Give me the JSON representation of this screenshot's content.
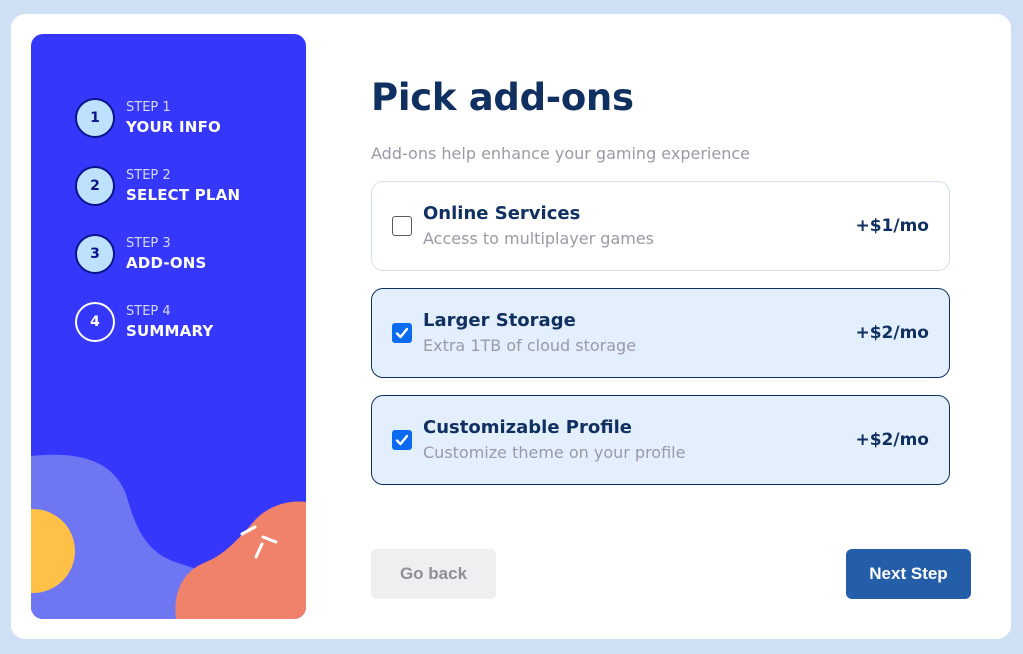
{
  "steps": [
    {
      "number": "1",
      "kicker": "STEP 1",
      "title": "YOUR INFO",
      "active": true
    },
    {
      "number": "2",
      "kicker": "STEP 2",
      "title": "SELECT PLAN",
      "active": true
    },
    {
      "number": "3",
      "kicker": "STEP 3",
      "title": "ADD-ONS",
      "active": true
    },
    {
      "number": "4",
      "kicker": "STEP 4",
      "title": "SUMMARY",
      "active": false
    }
  ],
  "main": {
    "title": "Pick add-ons",
    "subtitle": "Add-ons help enhance your gaming experience"
  },
  "addons": [
    {
      "name": "Online Services",
      "description": "Access to multiplayer games",
      "price": "+$1/mo",
      "checked": false
    },
    {
      "name": "Larger Storage",
      "description": "Extra 1TB of cloud storage",
      "price": "+$2/mo",
      "checked": true
    },
    {
      "name": "Customizable Profile",
      "description": "Customize theme on your profile",
      "price": "+$2/mo",
      "checked": true
    }
  ],
  "buttons": {
    "back_label": "Go back",
    "next_label": "Next Step"
  },
  "colors": {
    "sidebar": "#3538fb",
    "marine": "#0f3060",
    "accent": "#245da8",
    "checkbox": "#0a6bf2"
  }
}
